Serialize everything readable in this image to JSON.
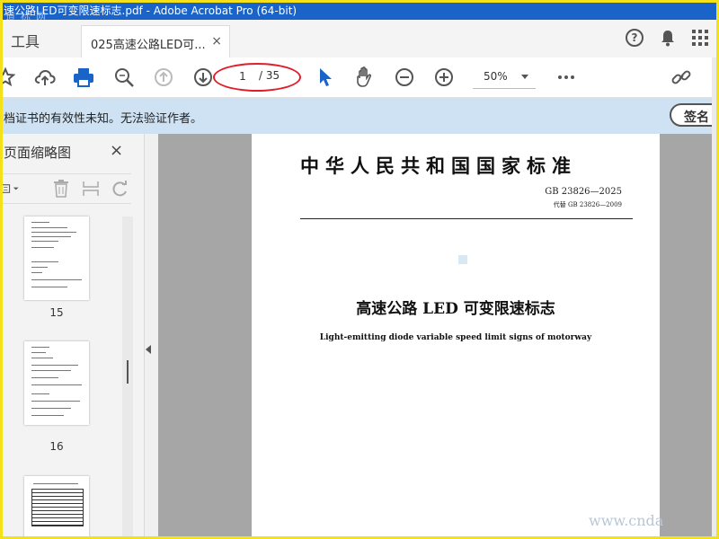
{
  "window": {
    "title": "速公路LED可变限速标志.pdf - Adobe Acrobat Pro (64-bit)",
    "watermark": "道标网",
    "controls": [
      "—",
      "☐",
      "✕"
    ]
  },
  "tabs": {
    "tools_label": "工具",
    "document_tab_label": "025高速公路LED可...",
    "document_tab_close": "×"
  },
  "toolbar": {
    "current_page": "1",
    "total_pages": "/ 35",
    "zoom": "50%"
  },
  "infobar": {
    "message": "档证书的有效性未知。无法验证作者。",
    "sign_button": "签名"
  },
  "sidebar": {
    "title": "页面缩略图",
    "close": "×",
    "thumbnails": [
      {
        "label": "15"
      },
      {
        "label": "16"
      },
      {
        "label": ""
      }
    ]
  },
  "document": {
    "header": "中华人民共和国国家标准",
    "standard_no": "GB 23826—2025",
    "replaces": "代替 GB 23826—2009",
    "title": "高速公路 LED 可变限速标志",
    "subtitle": "Light-emitting diode variable speed limit signs of motorway"
  },
  "overlay": {
    "site_watermark": "www.cnda"
  },
  "colors": {
    "titlebar": "#1a63c9",
    "frame": "#f5e11a",
    "infobar": "#cfe2f3",
    "highlight_oval": "#e11d2a",
    "doc_background": "#a6a6a6"
  }
}
